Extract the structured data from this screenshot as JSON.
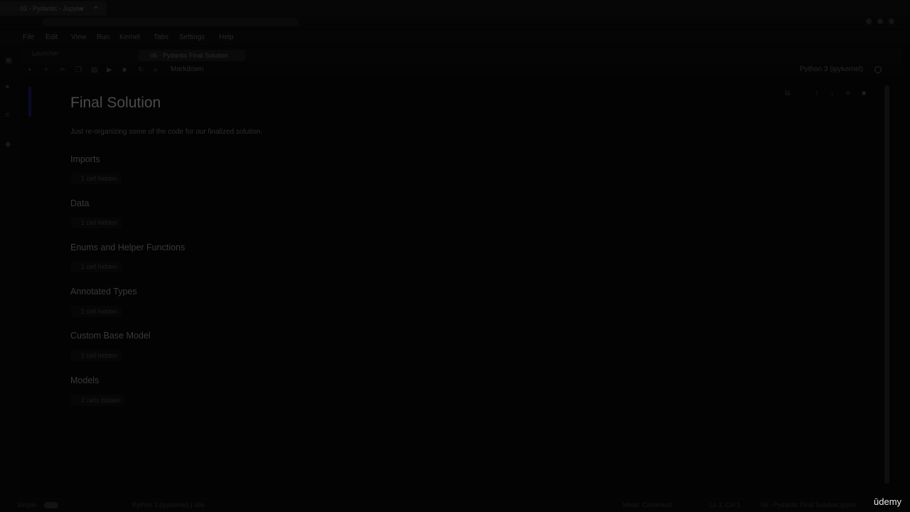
{
  "browser": {
    "tab_title": "03 - Pydantic - Jupyter",
    "close_glyph": "×",
    "new_tab_glyph": "+"
  },
  "menu": {
    "items": [
      "File",
      "Edit",
      "View",
      "Run",
      "Kernel",
      "Tabs",
      "Settings",
      "Help"
    ]
  },
  "file_tabs": {
    "launcher": "Launcher",
    "active": "06 - Pydantic Final Solution"
  },
  "toolbar": {
    "cell_type": "Markdown",
    "kernel": "Python 3 (ipykernel)"
  },
  "notebook": {
    "title": "Final Solution",
    "description": "Just re-organizing some of the code for our finalized solution.",
    "sections": [
      {
        "heading": "Imports",
        "hidden": "1 cell hidden"
      },
      {
        "heading": "Data",
        "hidden": "1 cell hidden"
      },
      {
        "heading": "Enums and Helper Functions",
        "hidden": "1 cell hidden"
      },
      {
        "heading": "Annotated Types",
        "hidden": "1 cell hidden"
      },
      {
        "heading": "Custom Base Model",
        "hidden": "1 cell hidden"
      },
      {
        "heading": "Models",
        "hidden": "2 cells hidden"
      }
    ]
  },
  "status": {
    "mode": "Simple",
    "kernel_status": "Python 3 (ipykernel) | Idle",
    "mode_right": "Mode: Command",
    "position": "Ln 1, Col 1",
    "file": "06 - Pydantic Final Solution.ipynb"
  },
  "watermark": "ūdemy"
}
